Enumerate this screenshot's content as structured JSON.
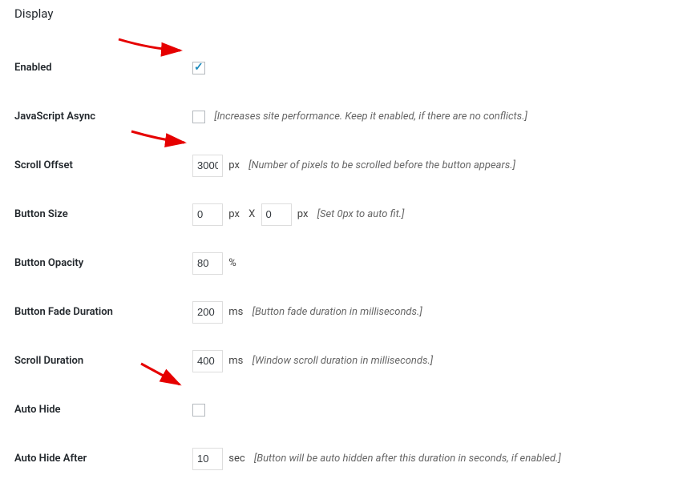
{
  "section": {
    "title": "Display"
  },
  "rows": {
    "enabled": {
      "label": "Enabled",
      "checked": true
    },
    "js_async": {
      "label": "JavaScript Async",
      "checked": false,
      "hint": "[Increases site performance. Keep it enabled, if there are no conflicts.]"
    },
    "scroll_offset": {
      "label": "Scroll Offset",
      "value": "3000",
      "unit": "px",
      "hint": "[Number of pixels to be scrolled before the button appears.]"
    },
    "button_size": {
      "label": "Button Size",
      "width": "0",
      "height": "0",
      "unit_w": "px",
      "x": "X",
      "unit_h": "px",
      "hint": "[Set 0px to auto fit.]"
    },
    "button_opacity": {
      "label": "Button Opacity",
      "value": "80",
      "unit": "%"
    },
    "button_fade": {
      "label": "Button Fade Duration",
      "value": "200",
      "unit": "ms",
      "hint": "[Button fade duration in milliseconds.]"
    },
    "scroll_duration": {
      "label": "Scroll Duration",
      "value": "400",
      "unit": "ms",
      "hint": "[Window scroll duration in milliseconds.]"
    },
    "auto_hide": {
      "label": "Auto Hide",
      "checked": false
    },
    "auto_hide_after": {
      "label": "Auto Hide After",
      "value": "10",
      "unit": "sec",
      "hint": "[Button will be auto hidden after this duration in seconds, if enabled.]"
    }
  }
}
